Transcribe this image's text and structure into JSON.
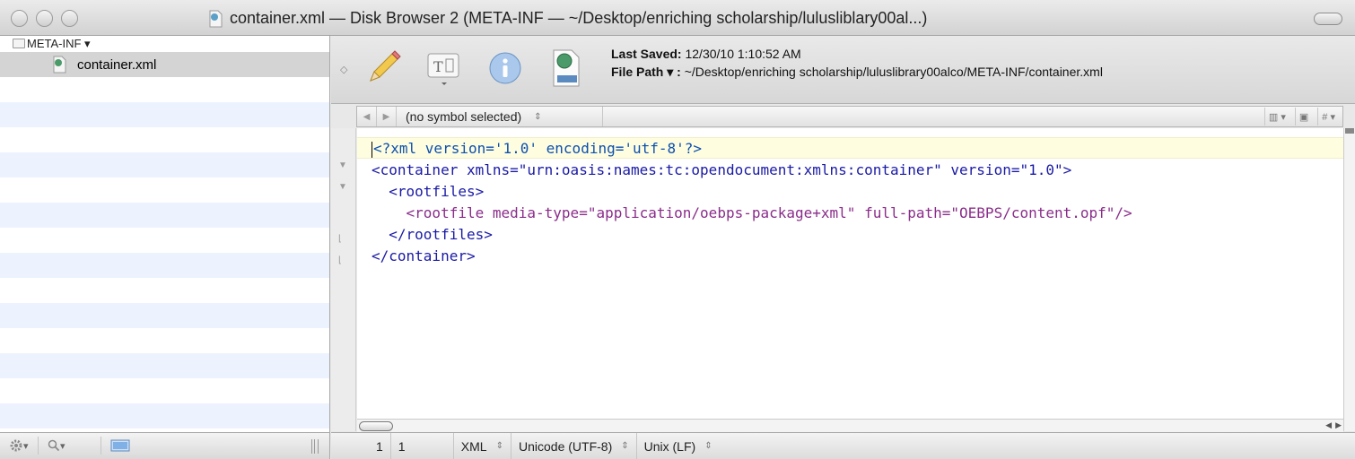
{
  "window": {
    "title": "container.xml — Disk Browser 2 (META-INF — ~/Desktop/enriching scholarship/lulusliblary00al...)"
  },
  "sidebar": {
    "folder_label": "META-INF ▾",
    "selected_file": "container.xml"
  },
  "toolbar": {
    "last_saved_label": "Last Saved:",
    "last_saved_value": "12/30/10 1:10:52 AM",
    "file_path_label": "File Path ▾ :",
    "file_path_value": "~/Desktop/enriching scholarship/luluslibrary00alco/META-INF/container.xml"
  },
  "navbar": {
    "symbol": "(no symbol selected)"
  },
  "editor": {
    "lines": [
      "<?xml version='1.0' encoding='utf-8'?>",
      "<container xmlns=\"urn:oasis:names:tc:opendocument:xmlns:container\" version=\"1.0\">",
      "  <rootfiles>",
      "    <rootfile media-type=\"application/oebps-package+xml\" full-path=\"OEBPS/content.opf\"/>",
      "  </rootfiles>",
      "</container>"
    ]
  },
  "status": {
    "line": "1",
    "column": "1",
    "language": "XML",
    "encoding": "Unicode (UTF-8)",
    "line_endings": "Unix (LF)"
  }
}
